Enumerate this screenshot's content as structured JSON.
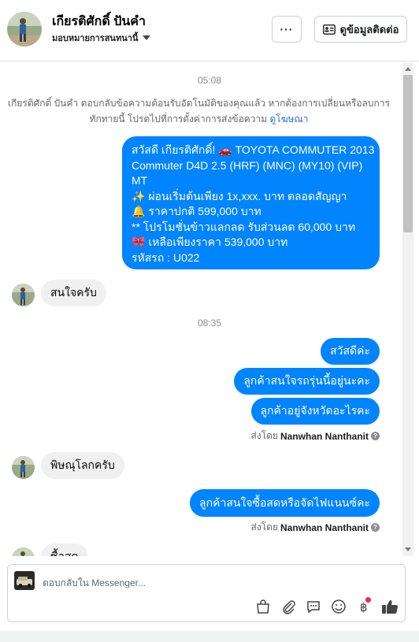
{
  "header": {
    "contact_name": "เกียรติศักดิ์ ปันคำ",
    "assign_label": "มอบหมายการสนทนานี้",
    "more_label": "···",
    "contact_button_label": "ดูข้อมูลติดต่อ"
  },
  "thread": {
    "time_1": "05:08",
    "system_message": "เกียรติศักดิ์ ปันคำ ตอบกลับข้อความต้อนรับอัตโนมัติของคุณแล้ว หากต้องการเปลี่ยนหรือลบการทักทายนี้ โปรดไปที่การตั้งค่าการส่งข้อความ",
    "system_link": "ดูโฆษณา",
    "welcome_lines": [
      "สวัสดี เกียรติศักดิ์! 🚗  TOYOTA COMMUTER 2013",
      "Commuter D4D 2.5 (HRF) (MNC) (MY10) (VIP)",
      "MT",
      "✨  ผ่อนเริ่มต้นเพียง 1x,xxx. บาท ตลอดสัญญา",
      "🔔 ราคาปกติ 599,000 บาท",
      "** โปรโมชั่นข้าวแลกลด รับส่วนลด 60,000 บาท",
      "🎀  เหลือเพียงราคา 539,000 บาท",
      " รหัสรถ : U022"
    ],
    "reply_1": "สนใจครับ",
    "time_2": "08:35",
    "out_1": "สวัสดีค่ะ",
    "out_2": "ลูกค้าสนใจรถรุ่นนี้อยู่นะคะ",
    "out_3": "ลูกค้าอยู่จังหวัดอะไรคะ",
    "sent_by_label": "ส่งโดย",
    "sent_by_name": "Nanwhan Nanthanit",
    "reply_2": "พิษณุโลกครับ",
    "out_4": "ลูกค้าสนใจซื้อสดหรือจัดไฟแนนซ์คะ",
    "reply_3": "ซื้อสด"
  },
  "composer": {
    "placeholder": "ตอบกลับใน Messenger..."
  },
  "icons": [
    "more-icon",
    "contact-card-icon",
    "bag-icon",
    "attach-icon",
    "saved-reply-icon",
    "emoji-icon",
    "baht-icon",
    "like-icon"
  ],
  "colors": {
    "accent": "#0084ff",
    "link": "#216fdb",
    "incoming": "#f0f0f0",
    "badge": "#f02849"
  }
}
